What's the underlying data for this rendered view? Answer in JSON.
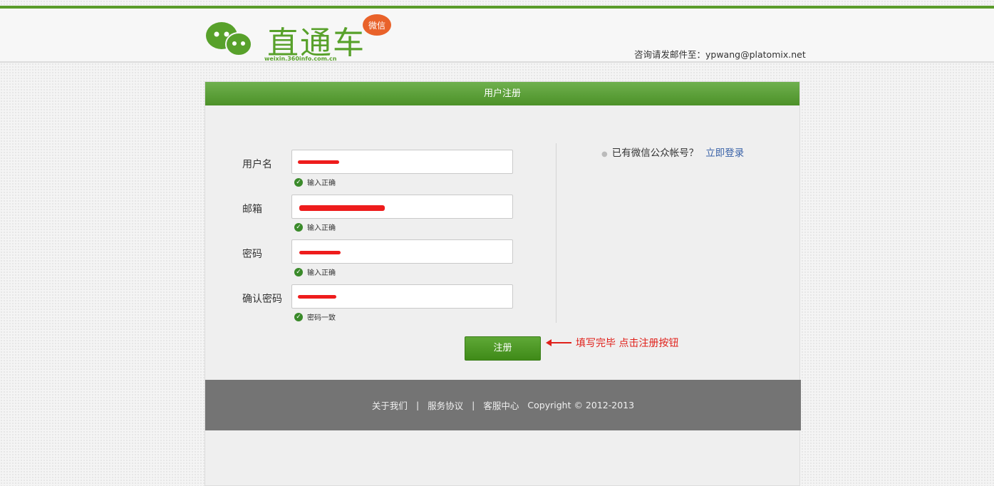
{
  "header": {
    "logo_text": "直通车",
    "logo_url": "weixin.360info.com.cn",
    "logo_badge": "微信",
    "contact": "咨询请发邮件至：ypwang@platomix.net"
  },
  "panel": {
    "title": "用户注册",
    "fields": [
      {
        "label": "用户名",
        "status": "输入正确"
      },
      {
        "label": "邮箱",
        "status": "输入正确"
      },
      {
        "label": "密码",
        "status": "输入正确"
      },
      {
        "label": "确认密码",
        "status": "密码一致"
      }
    ],
    "side_text": "已有微信公众帐号？",
    "side_link": "立即登录",
    "submit_label": "注册",
    "note": "填写完毕 点击注册按钮"
  },
  "footer": {
    "about": "关于我们",
    "sep1": "|",
    "terms": "服务协议",
    "sep2": "|",
    "support": "客服中心",
    "copyright": "Copyright © 2012-2013"
  },
  "colors": {
    "brand_green": "#58a12b",
    "annotation_red": "#e0211b",
    "link_blue": "#3b63a8"
  }
}
